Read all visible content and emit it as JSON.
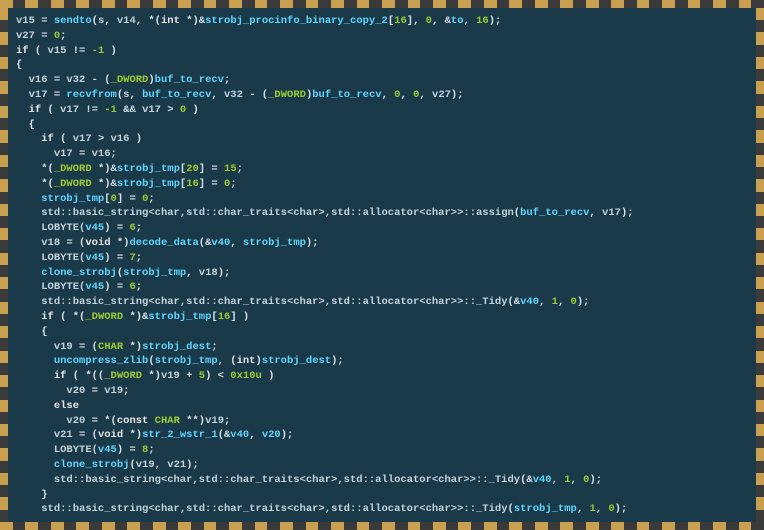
{
  "border_segments_h": 60,
  "border_segments_v": 42,
  "lines": [
    {
      "indent": 0,
      "tokens": [
        {
          "t": "id",
          "v": "v15"
        },
        {
          "t": "op",
          "v": " = "
        },
        {
          "t": "func",
          "v": "sendto"
        },
        {
          "t": "punc",
          "v": "("
        },
        {
          "t": "id",
          "v": "s"
        },
        {
          "t": "punc",
          "v": ", "
        },
        {
          "t": "id",
          "v": "v14"
        },
        {
          "t": "punc",
          "v": ", *("
        },
        {
          "t": "kw",
          "v": "int"
        },
        {
          "t": "punc",
          "v": " *)&"
        },
        {
          "t": "gvar",
          "v": "strobj_procinfo_binary_copy_2"
        },
        {
          "t": "punc",
          "v": "["
        },
        {
          "t": "num",
          "v": "16"
        },
        {
          "t": "punc",
          "v": "], "
        },
        {
          "t": "num",
          "v": "0"
        },
        {
          "t": "punc",
          "v": ", &"
        },
        {
          "t": "gvar",
          "v": "to"
        },
        {
          "t": "punc",
          "v": ", "
        },
        {
          "t": "num",
          "v": "16"
        },
        {
          "t": "punc",
          "v": ");"
        }
      ]
    },
    {
      "indent": 0,
      "tokens": [
        {
          "t": "id",
          "v": "v27"
        },
        {
          "t": "op",
          "v": " = "
        },
        {
          "t": "num",
          "v": "0"
        },
        {
          "t": "punc",
          "v": ";"
        }
      ]
    },
    {
      "indent": 0,
      "tokens": [
        {
          "t": "kw",
          "v": "if"
        },
        {
          "t": "punc",
          "v": " ( "
        },
        {
          "t": "id",
          "v": "v15"
        },
        {
          "t": "op",
          "v": " != "
        },
        {
          "t": "num",
          "v": "-1"
        },
        {
          "t": "punc",
          "v": " )"
        }
      ]
    },
    {
      "indent": 0,
      "tokens": [
        {
          "t": "punc",
          "v": "{"
        }
      ]
    },
    {
      "indent": 1,
      "tokens": [
        {
          "t": "id",
          "v": "v16"
        },
        {
          "t": "op",
          "v": " = "
        },
        {
          "t": "id",
          "v": "v32"
        },
        {
          "t": "op",
          "v": " - ("
        },
        {
          "t": "type",
          "v": "_DWORD"
        },
        {
          "t": "punc",
          "v": ")"
        },
        {
          "t": "gvar",
          "v": "buf_to_recv"
        },
        {
          "t": "punc",
          "v": ";"
        }
      ]
    },
    {
      "indent": 1,
      "tokens": [
        {
          "t": "id",
          "v": "v17"
        },
        {
          "t": "op",
          "v": " = "
        },
        {
          "t": "func",
          "v": "recvfrom"
        },
        {
          "t": "punc",
          "v": "("
        },
        {
          "t": "id",
          "v": "s"
        },
        {
          "t": "punc",
          "v": ", "
        },
        {
          "t": "gvar",
          "v": "buf_to_recv"
        },
        {
          "t": "punc",
          "v": ", "
        },
        {
          "t": "id",
          "v": "v32"
        },
        {
          "t": "op",
          "v": " - ("
        },
        {
          "t": "type",
          "v": "_DWORD"
        },
        {
          "t": "punc",
          "v": ")"
        },
        {
          "t": "gvar",
          "v": "buf_to_recv"
        },
        {
          "t": "punc",
          "v": ", "
        },
        {
          "t": "num",
          "v": "0"
        },
        {
          "t": "punc",
          "v": ", "
        },
        {
          "t": "num",
          "v": "0"
        },
        {
          "t": "punc",
          "v": ", "
        },
        {
          "t": "id",
          "v": "v27"
        },
        {
          "t": "punc",
          "v": ");"
        }
      ]
    },
    {
      "indent": 1,
      "tokens": [
        {
          "t": "kw",
          "v": "if"
        },
        {
          "t": "punc",
          "v": " ( "
        },
        {
          "t": "id",
          "v": "v17"
        },
        {
          "t": "op",
          "v": " != "
        },
        {
          "t": "num",
          "v": "-1"
        },
        {
          "t": "op",
          "v": " && "
        },
        {
          "t": "id",
          "v": "v17"
        },
        {
          "t": "op",
          "v": " > "
        },
        {
          "t": "num",
          "v": "0"
        },
        {
          "t": "punc",
          "v": " )"
        }
      ]
    },
    {
      "indent": 1,
      "tokens": [
        {
          "t": "punc",
          "v": "{"
        }
      ]
    },
    {
      "indent": 2,
      "tokens": [
        {
          "t": "kw",
          "v": "if"
        },
        {
          "t": "punc",
          "v": " ( "
        },
        {
          "t": "id",
          "v": "v17"
        },
        {
          "t": "op",
          "v": " > "
        },
        {
          "t": "id",
          "v": "v16"
        },
        {
          "t": "punc",
          "v": " )"
        }
      ]
    },
    {
      "indent": 3,
      "tokens": [
        {
          "t": "id",
          "v": "v17"
        },
        {
          "t": "op",
          "v": " = "
        },
        {
          "t": "id",
          "v": "v16"
        },
        {
          "t": "punc",
          "v": ";"
        }
      ]
    },
    {
      "indent": 2,
      "tokens": [
        {
          "t": "punc",
          "v": "*("
        },
        {
          "t": "type",
          "v": "_DWORD"
        },
        {
          "t": "punc",
          "v": " *)&"
        },
        {
          "t": "gvar",
          "v": "strobj_tmp"
        },
        {
          "t": "punc",
          "v": "["
        },
        {
          "t": "num",
          "v": "20"
        },
        {
          "t": "punc",
          "v": "] = "
        },
        {
          "t": "num",
          "v": "15"
        },
        {
          "t": "punc",
          "v": ";"
        }
      ]
    },
    {
      "indent": 2,
      "tokens": [
        {
          "t": "punc",
          "v": "*("
        },
        {
          "t": "type",
          "v": "_DWORD"
        },
        {
          "t": "punc",
          "v": " *)&"
        },
        {
          "t": "gvar",
          "v": "strobj_tmp"
        },
        {
          "t": "punc",
          "v": "["
        },
        {
          "t": "num",
          "v": "16"
        },
        {
          "t": "punc",
          "v": "] = "
        },
        {
          "t": "num",
          "v": "0"
        },
        {
          "t": "punc",
          "v": ";"
        }
      ]
    },
    {
      "indent": 2,
      "tokens": [
        {
          "t": "gvar",
          "v": "strobj_tmp"
        },
        {
          "t": "punc",
          "v": "["
        },
        {
          "t": "num",
          "v": "0"
        },
        {
          "t": "punc",
          "v": "] = "
        },
        {
          "t": "num",
          "v": "0"
        },
        {
          "t": "punc",
          "v": ";"
        }
      ]
    },
    {
      "indent": 2,
      "tokens": [
        {
          "t": "id",
          "v": "std::basic_string<char,std::char_traits<char>,std::allocator<char>>::assign"
        },
        {
          "t": "punc",
          "v": "("
        },
        {
          "t": "gvar",
          "v": "buf_to_recv"
        },
        {
          "t": "punc",
          "v": ", "
        },
        {
          "t": "id",
          "v": "v17"
        },
        {
          "t": "punc",
          "v": ");"
        }
      ]
    },
    {
      "indent": 2,
      "tokens": [
        {
          "t": "id",
          "v": "LOBYTE("
        },
        {
          "t": "gvar",
          "v": "v45"
        },
        {
          "t": "punc",
          "v": ") = "
        },
        {
          "t": "num",
          "v": "6"
        },
        {
          "t": "punc",
          "v": ";"
        }
      ]
    },
    {
      "indent": 2,
      "tokens": [
        {
          "t": "id",
          "v": "v18"
        },
        {
          "t": "op",
          "v": " = ("
        },
        {
          "t": "kw",
          "v": "void"
        },
        {
          "t": "punc",
          "v": " *)"
        },
        {
          "t": "func",
          "v": "decode_data"
        },
        {
          "t": "punc",
          "v": "(&"
        },
        {
          "t": "gvar",
          "v": "v40"
        },
        {
          "t": "punc",
          "v": ", "
        },
        {
          "t": "gvar",
          "v": "strobj_tmp"
        },
        {
          "t": "punc",
          "v": ");"
        }
      ]
    },
    {
      "indent": 2,
      "tokens": [
        {
          "t": "id",
          "v": "LOBYTE("
        },
        {
          "t": "gvar",
          "v": "v45"
        },
        {
          "t": "punc",
          "v": ") = "
        },
        {
          "t": "num",
          "v": "7"
        },
        {
          "t": "punc",
          "v": ";"
        }
      ]
    },
    {
      "indent": 2,
      "tokens": [
        {
          "t": "func",
          "v": "clone_strobj"
        },
        {
          "t": "punc",
          "v": "("
        },
        {
          "t": "gvar",
          "v": "strobj_tmp"
        },
        {
          "t": "punc",
          "v": ", "
        },
        {
          "t": "id",
          "v": "v18"
        },
        {
          "t": "punc",
          "v": ");"
        }
      ]
    },
    {
      "indent": 2,
      "tokens": [
        {
          "t": "id",
          "v": "LOBYTE("
        },
        {
          "t": "gvar",
          "v": "v45"
        },
        {
          "t": "punc",
          "v": ") = "
        },
        {
          "t": "num",
          "v": "6"
        },
        {
          "t": "punc",
          "v": ";"
        }
      ]
    },
    {
      "indent": 2,
      "tokens": [
        {
          "t": "id",
          "v": "std::basic_string<char,std::char_traits<char>,std::allocator<char>>::_Tidy"
        },
        {
          "t": "punc",
          "v": "(&"
        },
        {
          "t": "gvar",
          "v": "v40"
        },
        {
          "t": "punc",
          "v": ", "
        },
        {
          "t": "num",
          "v": "1"
        },
        {
          "t": "punc",
          "v": ", "
        },
        {
          "t": "num",
          "v": "0"
        },
        {
          "t": "punc",
          "v": ");"
        }
      ]
    },
    {
      "indent": 2,
      "tokens": [
        {
          "t": "kw",
          "v": "if"
        },
        {
          "t": "punc",
          "v": " ( *("
        },
        {
          "t": "type",
          "v": "_DWORD"
        },
        {
          "t": "punc",
          "v": " *)&"
        },
        {
          "t": "gvar",
          "v": "strobj_tmp"
        },
        {
          "t": "punc",
          "v": "["
        },
        {
          "t": "num",
          "v": "16"
        },
        {
          "t": "punc",
          "v": "] )"
        }
      ]
    },
    {
      "indent": 2,
      "tokens": [
        {
          "t": "punc",
          "v": "{"
        }
      ]
    },
    {
      "indent": 3,
      "tokens": [
        {
          "t": "id",
          "v": "v19"
        },
        {
          "t": "op",
          "v": " = ("
        },
        {
          "t": "type",
          "v": "CHAR"
        },
        {
          "t": "punc",
          "v": " *)"
        },
        {
          "t": "gvar",
          "v": "strobj_dest"
        },
        {
          "t": "punc",
          "v": ";"
        }
      ]
    },
    {
      "indent": 3,
      "tokens": [
        {
          "t": "func",
          "v": "uncompress_zlib"
        },
        {
          "t": "punc",
          "v": "("
        },
        {
          "t": "gvar",
          "v": "strobj_tmp"
        },
        {
          "t": "punc",
          "v": ", ("
        },
        {
          "t": "kw",
          "v": "int"
        },
        {
          "t": "punc",
          "v": ")"
        },
        {
          "t": "gvar",
          "v": "strobj_dest"
        },
        {
          "t": "punc",
          "v": ");"
        }
      ]
    },
    {
      "indent": 3,
      "tokens": [
        {
          "t": "kw",
          "v": "if"
        },
        {
          "t": "punc",
          "v": " ( *(("
        },
        {
          "t": "type",
          "v": "_DWORD"
        },
        {
          "t": "punc",
          "v": " *)"
        },
        {
          "t": "id",
          "v": "v19"
        },
        {
          "t": "op",
          "v": " + "
        },
        {
          "t": "num",
          "v": "5"
        },
        {
          "t": "punc",
          "v": ") < "
        },
        {
          "t": "num",
          "v": "0x10u"
        },
        {
          "t": "punc",
          "v": " )"
        }
      ]
    },
    {
      "indent": 4,
      "tokens": [
        {
          "t": "id",
          "v": "v20"
        },
        {
          "t": "op",
          "v": " = "
        },
        {
          "t": "id",
          "v": "v19"
        },
        {
          "t": "punc",
          "v": ";"
        }
      ]
    },
    {
      "indent": 3,
      "tokens": [
        {
          "t": "kw",
          "v": "else"
        }
      ]
    },
    {
      "indent": 4,
      "tokens": [
        {
          "t": "id",
          "v": "v20"
        },
        {
          "t": "op",
          "v": " = *("
        },
        {
          "t": "kw",
          "v": "const"
        },
        {
          "t": "punc",
          "v": " "
        },
        {
          "t": "type",
          "v": "CHAR"
        },
        {
          "t": "punc",
          "v": " **)"
        },
        {
          "t": "id",
          "v": "v19"
        },
        {
          "t": "punc",
          "v": ";"
        }
      ]
    },
    {
      "indent": 3,
      "tokens": [
        {
          "t": "id",
          "v": "v21"
        },
        {
          "t": "op",
          "v": " = ("
        },
        {
          "t": "kw",
          "v": "void"
        },
        {
          "t": "punc",
          "v": " *)"
        },
        {
          "t": "func",
          "v": "str_2_wstr_1"
        },
        {
          "t": "punc",
          "v": "(&"
        },
        {
          "t": "gvar",
          "v": "v40"
        },
        {
          "t": "punc",
          "v": ", "
        },
        {
          "t": "gvar",
          "v": "v20"
        },
        {
          "t": "punc",
          "v": ");"
        }
      ]
    },
    {
      "indent": 3,
      "tokens": [
        {
          "t": "id",
          "v": "LOBYTE("
        },
        {
          "t": "gvar",
          "v": "v45"
        },
        {
          "t": "punc",
          "v": ") = "
        },
        {
          "t": "num",
          "v": "8"
        },
        {
          "t": "punc",
          "v": ";"
        }
      ]
    },
    {
      "indent": 3,
      "tokens": [
        {
          "t": "func",
          "v": "clone_strobj"
        },
        {
          "t": "punc",
          "v": "("
        },
        {
          "t": "id",
          "v": "v19"
        },
        {
          "t": "punc",
          "v": ", "
        },
        {
          "t": "id",
          "v": "v21"
        },
        {
          "t": "punc",
          "v": ");"
        }
      ]
    },
    {
      "indent": 3,
      "tokens": [
        {
          "t": "id",
          "v": "std::basic_string<char,std::char_traits<char>,std::allocator<char>>::_Tidy"
        },
        {
          "t": "punc",
          "v": "(&"
        },
        {
          "t": "gvar",
          "v": "v40"
        },
        {
          "t": "punc",
          "v": ", "
        },
        {
          "t": "num",
          "v": "1"
        },
        {
          "t": "punc",
          "v": ", "
        },
        {
          "t": "num",
          "v": "0"
        },
        {
          "t": "punc",
          "v": ");"
        }
      ]
    },
    {
      "indent": 2,
      "tokens": [
        {
          "t": "punc",
          "v": "}"
        }
      ]
    },
    {
      "indent": 2,
      "tokens": [
        {
          "t": "id",
          "v": "std::basic_string<char,std::char_traits<char>,std::allocator<char>>::_Tidy"
        },
        {
          "t": "punc",
          "v": "("
        },
        {
          "t": "gvar",
          "v": "strobj_tmp"
        },
        {
          "t": "punc",
          "v": ", "
        },
        {
          "t": "num",
          "v": "1"
        },
        {
          "t": "punc",
          "v": ", "
        },
        {
          "t": "num",
          "v": "0"
        },
        {
          "t": "punc",
          "v": ");"
        }
      ]
    }
  ]
}
